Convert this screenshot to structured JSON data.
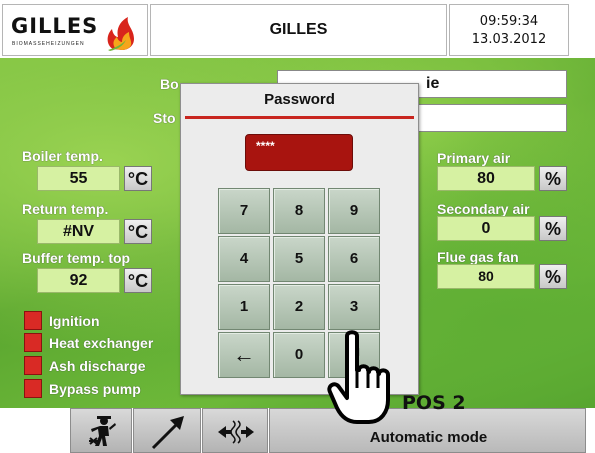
{
  "header": {
    "logo_text": "GILLES",
    "logo_subtitle": "BIOMASSEHEIZUNGEN",
    "title": "GILLES",
    "time": "09:59:34",
    "date": "13.03.2012"
  },
  "background_fields": {
    "row1_label_fragment": "Bo",
    "row1_value_fragment": "ie",
    "row2_label_fragment": "Sto",
    "row2_value_fragment": ""
  },
  "left_values": [
    {
      "label": "Boiler temp.",
      "value": "55",
      "unit": "°C"
    },
    {
      "label": "Return temp.",
      "value": "#NV",
      "unit": "°C"
    },
    {
      "label": "Buffer temp. top",
      "value": "92",
      "unit": "°C"
    }
  ],
  "right_values": [
    {
      "label": "Primary air",
      "value": "80",
      "unit": "%"
    },
    {
      "label": "Secondary air",
      "value": "0",
      "unit": "%"
    },
    {
      "label": "Flue gas fan",
      "value": "80",
      "unit": "%"
    }
  ],
  "indicators": [
    {
      "label": "Ignition"
    },
    {
      "label": "Heat exchanger"
    },
    {
      "label": "Ash discharge"
    },
    {
      "label": "Bypass pump"
    }
  ],
  "dialog": {
    "title": "Password",
    "masked_value": "****",
    "keys": [
      "7",
      "8",
      "9",
      "4",
      "5",
      "6",
      "1",
      "2",
      "3",
      "←",
      "0",
      "↵"
    ]
  },
  "bottom_bar": {
    "mode": "Automatic mode",
    "icons": [
      "chimney-sweep-icon",
      "arrow-up-right-icon",
      "flow-arrows-icon"
    ]
  },
  "overlay": {
    "pos_label": "POS 2"
  },
  "colors": {
    "accent_red": "#c8261f",
    "value_field": "#d6f1a2",
    "green_background": "#6cb83a"
  }
}
